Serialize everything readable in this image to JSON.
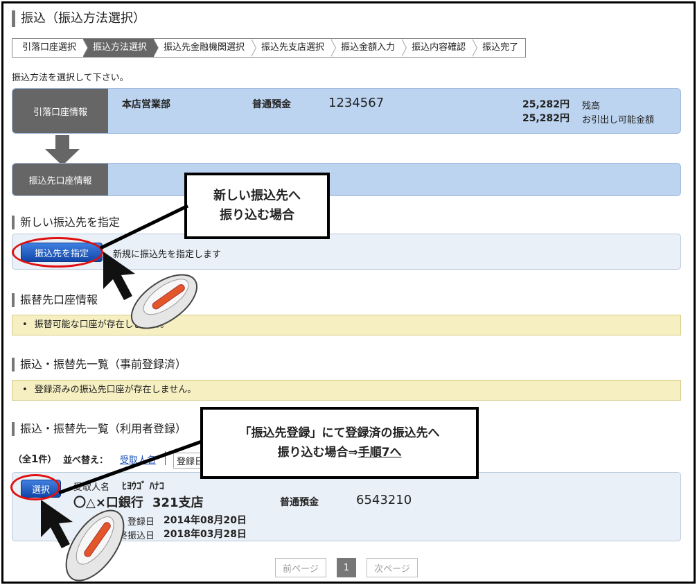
{
  "page": {
    "title": "振込（振込方法選択）",
    "instruction": "振込方法を選択して下さい。"
  },
  "steps": [
    {
      "label": "引落口座選択"
    },
    {
      "label": "振込方法選択"
    },
    {
      "label": "振込先金融機関選択"
    },
    {
      "label": "振込先支店選択"
    },
    {
      "label": "振込金額入力"
    },
    {
      "label": "振込内容確認"
    },
    {
      "label": "振込完了"
    }
  ],
  "source_account": {
    "label": "引落口座情報",
    "branch": "本店営業部",
    "type": "普通預金",
    "number": "1234567",
    "balance": "25,282円",
    "balance_label": "残高",
    "available": "25,282円",
    "available_label": "お引出し可能金額"
  },
  "dest_account": {
    "label": "振込先口座情報"
  },
  "new_payee": {
    "heading": "新しい振込先を指定",
    "button": "振込先を指定",
    "description": "新規に振込先を指定します"
  },
  "transfer_dest": {
    "heading": "振替先口座情報",
    "message": "振替可能な口座が存在しません。"
  },
  "preregistered": {
    "heading": "振込・振替先一覧（事前登録済）",
    "message": "登録済みの振込先口座が存在しません。"
  },
  "user_registered": {
    "heading": "振込・振替先一覧（利用者登録）",
    "count_prefix": "（全",
    "count": "1",
    "count_suffix": "件）",
    "sort_label": "並べ替え：",
    "sort_option_1": "受取人名",
    "sort_option_2": "登録日",
    "select_button": "選択",
    "recipient_label": "受取人名",
    "recipient_name": "ﾋﾖｳｺﾞ ﾊﾅｺ",
    "bank": "〇△×口銀行",
    "branch": "321支店",
    "account_type": "普通預金",
    "account_number": "6543210",
    "reg_date_label": "登録日",
    "reg_date": "2014年08月20日",
    "last_date_label": "最終振込日",
    "last_date": "2018年03月28日"
  },
  "pager": {
    "prev": "前ページ",
    "page": "1",
    "next": "次ページ"
  },
  "callouts": {
    "new_line1": "新しい振込先へ",
    "new_line2": "振り込む場合",
    "reg_line1": "「振込先登録」にて登録済の振込先へ",
    "reg_line2_prefix": "振り込む場合⇒",
    "reg_line2_link": "手順7へ"
  },
  "icons": [
    "arrow-down-icon",
    "mouse-icon",
    "pointer-arrow-icon"
  ]
}
